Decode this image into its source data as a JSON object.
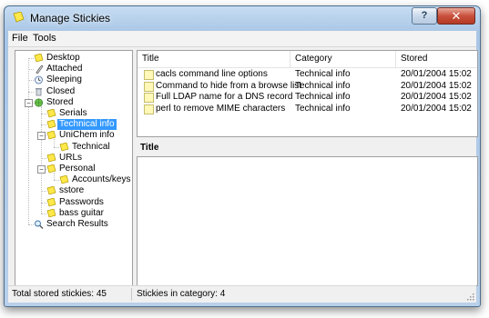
{
  "window": {
    "title": "Manage Stickies",
    "help_label": "?",
    "close_label": "✕"
  },
  "menu": {
    "items": [
      "File",
      "Tools"
    ]
  },
  "tree": {
    "items": [
      {
        "label": "Desktop",
        "icon": "sticky-note-icon"
      },
      {
        "label": "Attached",
        "icon": "paperclip-icon"
      },
      {
        "label": "Sleeping",
        "icon": "clock-icon"
      },
      {
        "label": "Closed",
        "icon": "trash-icon"
      },
      {
        "label": "Stored",
        "icon": "globe-icon"
      },
      {
        "label": "Serials",
        "icon": "sticky-note-icon"
      },
      {
        "label": "Technical info",
        "icon": "sticky-note-icon",
        "selected": true
      },
      {
        "label": "UniChem info",
        "icon": "sticky-note-icon"
      },
      {
        "label": "Technical",
        "icon": "sticky-note-icon"
      },
      {
        "label": "URLs",
        "icon": "sticky-note-icon"
      },
      {
        "label": "Personal",
        "icon": "sticky-note-icon"
      },
      {
        "label": "Accounts/keys",
        "icon": "sticky-note-icon"
      },
      {
        "label": "sstore",
        "icon": "sticky-note-icon"
      },
      {
        "label": "Passwords",
        "icon": "sticky-note-icon"
      },
      {
        "label": "bass guitar",
        "icon": "sticky-note-icon"
      },
      {
        "label": "Search Results",
        "icon": "magnifier-icon"
      }
    ]
  },
  "list": {
    "columns": [
      "Title",
      "Category",
      "Stored"
    ],
    "rows": [
      {
        "title": "cacls command line options",
        "category": "Technical info",
        "stored": "20/01/2004 15:02"
      },
      {
        "title": "Command to hide from a browse list",
        "category": "Technical info",
        "stored": "20/01/2004 15:02"
      },
      {
        "title": "Full LDAP name for a DNS record",
        "category": "Technical info",
        "stored": "20/01/2004 15:02"
      },
      {
        "title": "perl to remove MIME characters",
        "category": "Technical info",
        "stored": "20/01/2004 15:02"
      }
    ]
  },
  "details": {
    "title_label": "Title"
  },
  "status": {
    "total": "Total stored stickies: 45",
    "in_category": "Stickies in category: 4"
  },
  "colors": {
    "selection": "#3399ff",
    "sticky_yellow": "#fffbb0",
    "titlebar": "#b8d0ea",
    "close_button": "#c8503c"
  }
}
